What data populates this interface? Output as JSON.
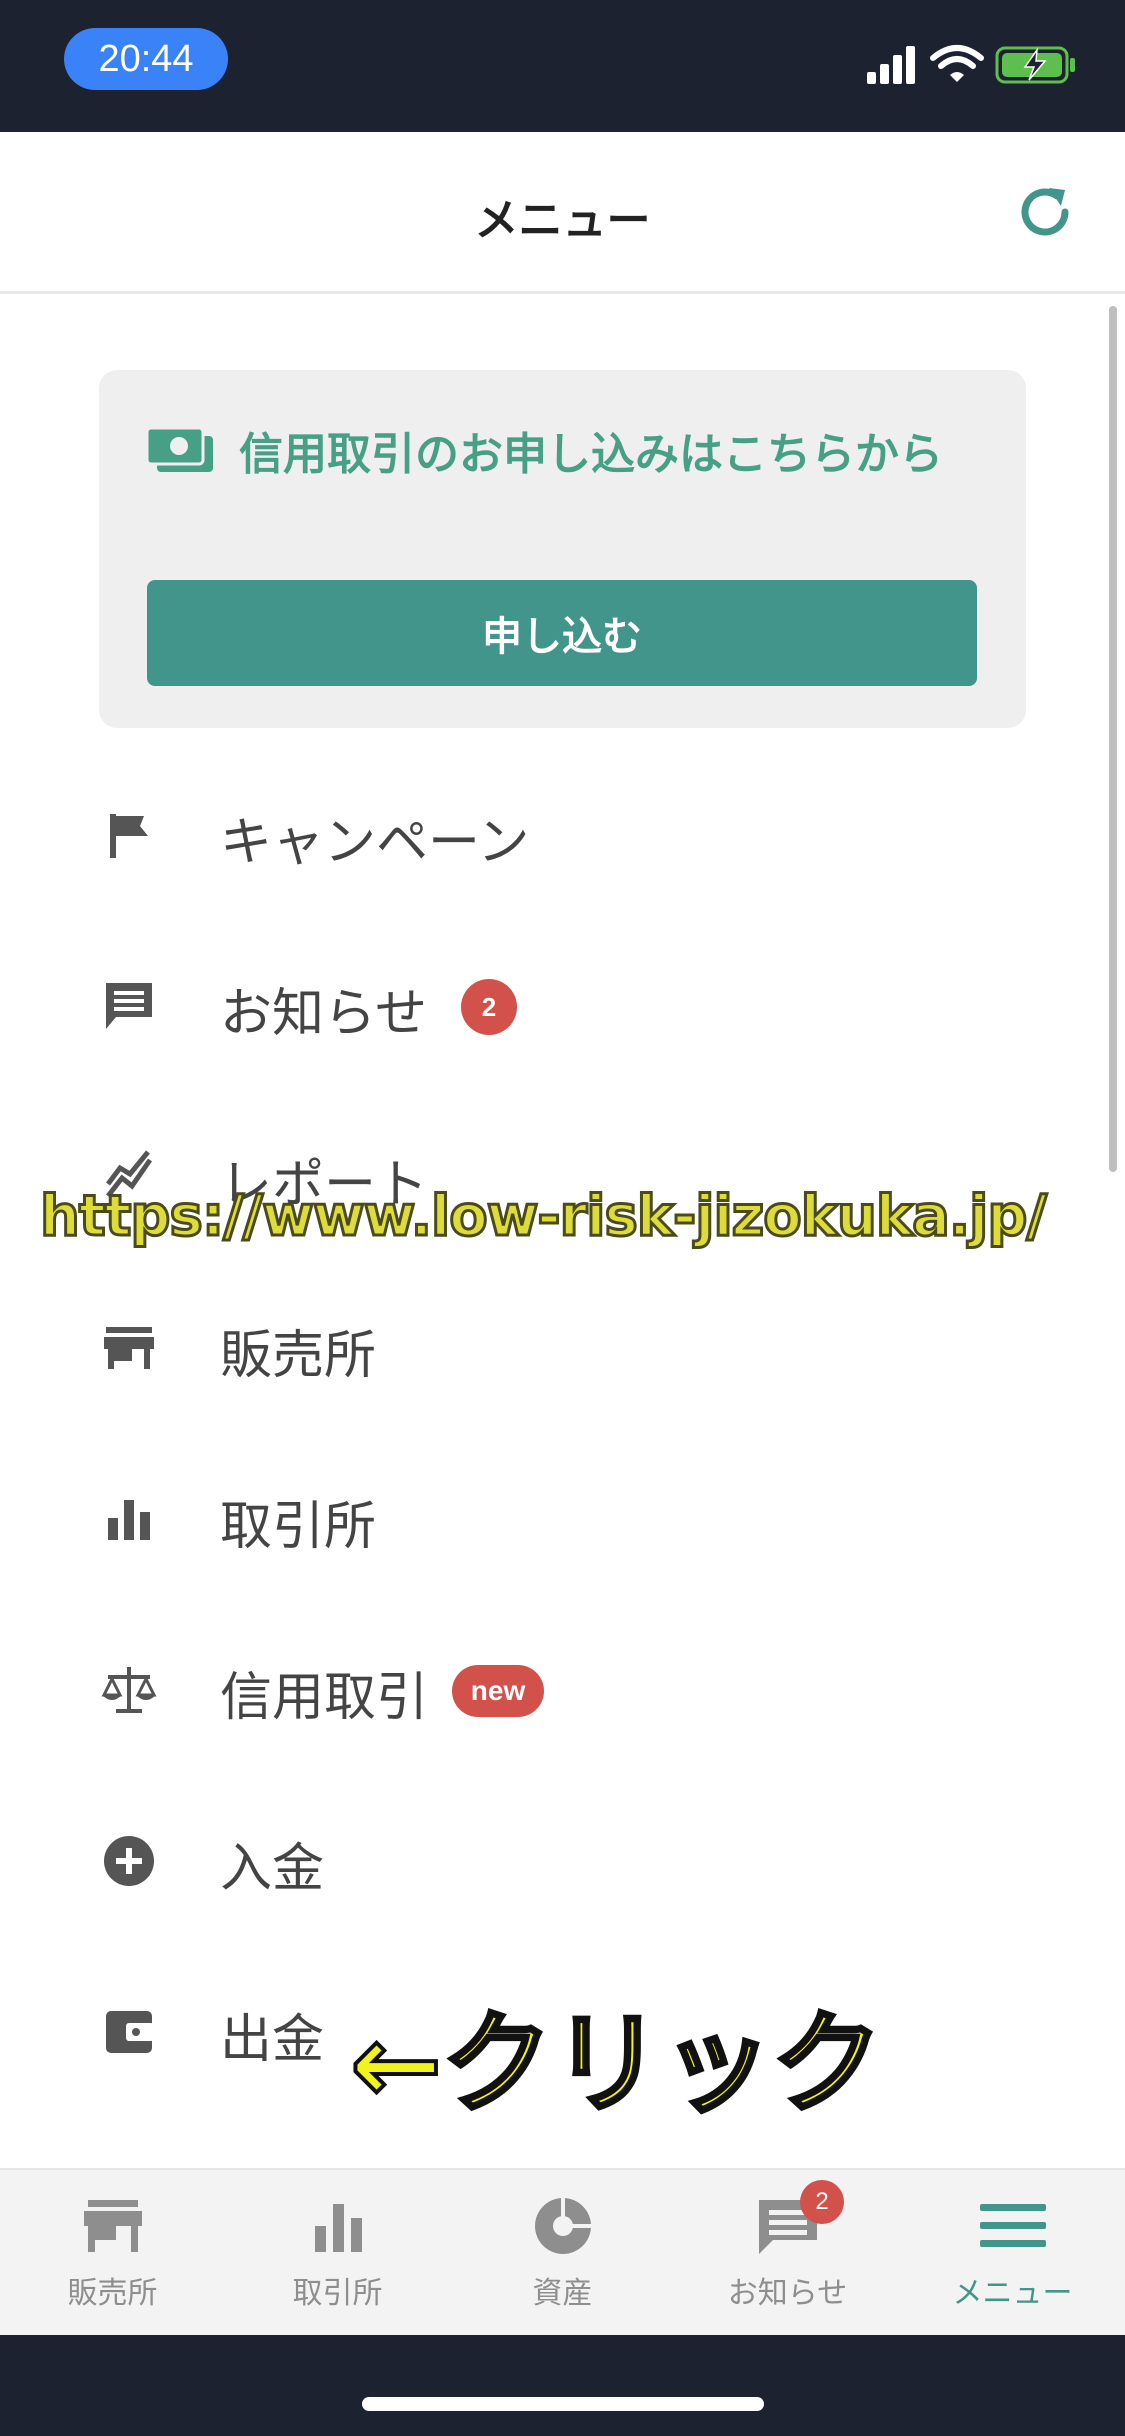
{
  "status_bar": {
    "time": "20:44",
    "icons": [
      "signal-icon",
      "wifi-icon",
      "battery-charging-icon"
    ]
  },
  "header": {
    "title": "メニュー",
    "refresh_icon": "refresh-icon"
  },
  "promo": {
    "icon": "money-icon",
    "text": "信用取引のお申し込みはこちらから",
    "button_label": "申し込む"
  },
  "menu": {
    "items": [
      {
        "label": "キャンペーン",
        "icon": "flag-icon"
      },
      {
        "label": "お知らせ",
        "icon": "chat-icon",
        "badge": "2"
      },
      {
        "label": "レポート",
        "icon": "chart-line-icon"
      },
      {
        "label": "販売所",
        "icon": "store-icon"
      },
      {
        "label": "取引所",
        "icon": "bar-chart-icon"
      },
      {
        "label": "信用取引",
        "icon": "scale-icon",
        "badge": "new"
      },
      {
        "label": "入金",
        "icon": "plus-circle-icon"
      },
      {
        "label": "出金",
        "icon": "wallet-icon"
      }
    ]
  },
  "overlay": {
    "watermark": "https://www.low-risk-jizokuka.jp/",
    "annotation": "←クリック"
  },
  "tab_bar": {
    "items": [
      {
        "label": "販売所",
        "icon": "store-icon"
      },
      {
        "label": "取引所",
        "icon": "bar-chart-icon"
      },
      {
        "label": "資産",
        "icon": "pie-chart-icon"
      },
      {
        "label": "お知らせ",
        "icon": "chat-icon",
        "badge": "2"
      },
      {
        "label": "メニュー",
        "icon": "hamburger-menu-icon",
        "active": true
      }
    ]
  },
  "colors": {
    "accent": "#41958a",
    "accent_text": "#47a085",
    "badge": "#d2514b",
    "status_bar_bg": "#1c2230",
    "time_pill": "#3a82f7"
  }
}
